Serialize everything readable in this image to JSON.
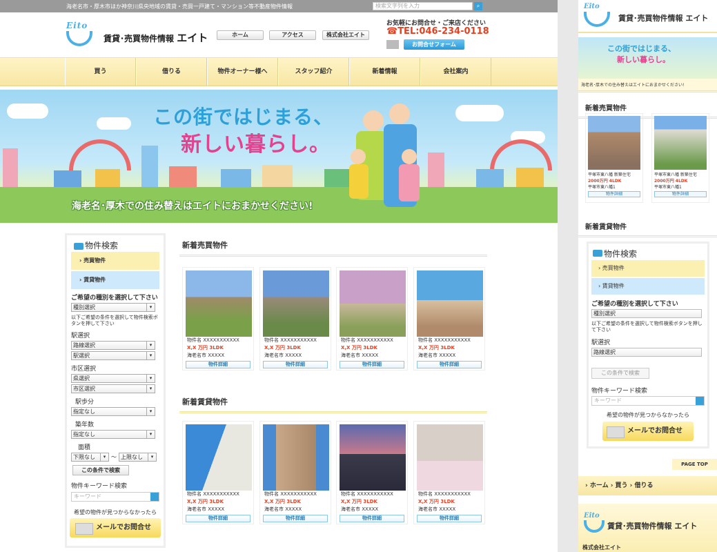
{
  "topbar": {
    "tagline": "海老名市・厚木市ほか神奈川県央地域の賃貸・売買一戸建て・マンション等不動産物件情報",
    "search_placeholder": "検索文字列を入力"
  },
  "header": {
    "brand_mark": "Eito",
    "brand_prefix": "賃貸･売買物件情報",
    "brand_name": "エイト",
    "nav": [
      "ホーム",
      "アクセス",
      "株式会社エイト"
    ],
    "contact_head": "お気軽にお問合せ・ご来店ください",
    "phone": "☎TEL:046-234-0118",
    "form_button": "お問合せフォーム"
  },
  "gnav": [
    "買う",
    "借りる",
    "物件オーナー様へ",
    "スタッフ紹介",
    "新着情報",
    "会社案内"
  ],
  "hero": {
    "line1": "この街ではじまる、",
    "line2": "新しい暮らし。",
    "tagline": "海老名･厚木での住み替えはエイトにおまかせください!"
  },
  "sidebar": {
    "title": "物件検索",
    "cat_sale": "売買物件",
    "cat_rent": "賃貸物件",
    "type_label": "ご希望の種別を選択して下さい",
    "type_select": "種別選択",
    "note": "以下ご希望の条件を選択して物件検索ボタンを押して下さい",
    "station_label": "駅選択",
    "line_select": "路線選択",
    "station_select": "駅選択",
    "city_label": "市区選択",
    "pref_select": "県選択",
    "city_select": "市区選択",
    "walk_label": "駅歩分",
    "walk_select": "指定なし",
    "age_label": "築年数",
    "age_select": "指定なし",
    "area_label": "面積",
    "area_min": "下限なし",
    "area_sep": "〜",
    "area_max": "上限なし",
    "search_btn": "この条件で検索",
    "kw_label": "物件キーワード検索",
    "kw_placeholder": "キーワード",
    "not_found": "希望の物件が見つからなかったら",
    "mail_btn": "メールでお問合せ"
  },
  "sale": {
    "title": "新着売買物件",
    "cards": [
      {
        "name": "物件名 XXXXXXXXXXX",
        "price": "X,X 万円 3LDK",
        "city": "海老名市 XXXXX",
        "btn": "物件詳細",
        "photo": "#7a9a5a"
      },
      {
        "name": "物件名 XXXXXXXXXXX",
        "price": "X,X 万円 3LDK",
        "city": "海老名市 XXXXX",
        "btn": "物件詳細",
        "photo": "#8a9aa8"
      },
      {
        "name": "物件名 XXXXXXXXXXX",
        "price": "X,X 万円 3LDK",
        "city": "海老名市 XXXXX",
        "btn": "物件詳細",
        "photo": "#c892b8"
      },
      {
        "name": "物件名 XXXXXXXXXXX",
        "price": "X,X 万円 3LDK",
        "city": "海老名市 XXXXX",
        "btn": "物件詳細",
        "photo": "#6aa7d0"
      }
    ]
  },
  "rent": {
    "title": "新着賃貸物件",
    "cards": [
      {
        "name": "物件名 XXXXXXXXXXX",
        "price": "X,X 万円 3LDK",
        "city": "海老名市 XXXXX",
        "btn": "物件詳細",
        "photo": "#4f8fcf"
      },
      {
        "name": "物件名 XXXXXXXXXXX",
        "price": "X,X 万円 3LDK",
        "city": "海老名市 XXXXX",
        "btn": "物件詳細",
        "photo": "#a88a6a"
      },
      {
        "name": "物件名 XXXXXXXXXXX",
        "price": "X,X 万円 3LDK",
        "city": "海老名市 XXXXX",
        "btn": "物件詳細",
        "photo": "#5a4a6a"
      },
      {
        "name": "物件名 XXXXXXXXXXX",
        "price": "X,X 万円 3LDK",
        "city": "海老名市 XXXXX",
        "btn": "物件詳細",
        "photo": "#d8c8c0"
      }
    ]
  },
  "sp": {
    "brand_mark": "Eito",
    "brand": "賃貸･売買物件情報 エイト",
    "banner1": "この街ではじまる、",
    "banner2": "新しい暮らし。",
    "caption": "海老名･厚木での住み替えはエイトにおまかせください!",
    "sale_title": "新着売買物件",
    "sale_cards": [
      {
        "name": "平塚市東八幡 新築住宅",
        "price": "2000万円 4LDK",
        "city": "平塚市東八幡1",
        "btn": "物件詳細"
      },
      {
        "name": "平塚市東八幡 新築住宅",
        "price": "2000万円 4LDK",
        "city": "平塚市東八幡1",
        "btn": "物件詳細"
      }
    ],
    "rent_title": "新着賃貸物件",
    "search": {
      "title": "物件検索",
      "cat_sale": "売買物件",
      "cat_rent": "賃貸物件",
      "type_label": "ご希望の種別を選択して下さい",
      "type_select": "種別選択",
      "note": "以下ご希望の条件を選択して物件検索ボタンを押して下さい",
      "station_label": "駅選択",
      "line_select": "路線選択",
      "search_btn": "この条件で検索",
      "kw_label": "物件キーワード検索",
      "kw_placeholder": "キーワード",
      "not_found": "希望の物件が見つからなかったら",
      "mail_btn": "メールでお問合せ"
    },
    "pagetop": "PAGE TOP",
    "crumb": "› ホーム  › 買う  › 借りる",
    "footer_brand": "賃貸･売買物件情報 エイト",
    "company": "株式会社エイト"
  }
}
